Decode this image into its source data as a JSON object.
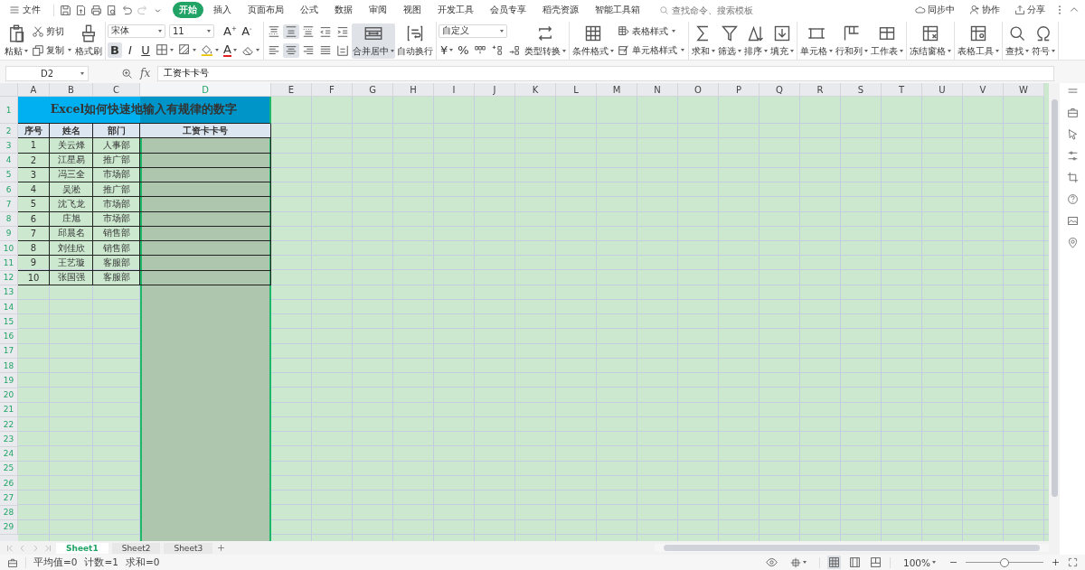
{
  "menu_bar": {
    "file_menu": "文件",
    "tabs": [
      {
        "label": "开始",
        "selected": true
      },
      {
        "label": "插入",
        "selected": false
      },
      {
        "label": "页面布局",
        "selected": false
      },
      {
        "label": "公式",
        "selected": false
      },
      {
        "label": "数据",
        "selected": false
      },
      {
        "label": "审阅",
        "selected": false
      },
      {
        "label": "视图",
        "selected": false
      },
      {
        "label": "开发工具",
        "selected": false
      },
      {
        "label": "会员专享",
        "selected": false
      },
      {
        "label": "稻壳资源",
        "selected": false
      },
      {
        "label": "智能工具箱",
        "selected": false
      }
    ],
    "search": {
      "placeholder": "查找命令、搜索模板"
    },
    "actions": [
      "同步中",
      "协作",
      "分享"
    ]
  },
  "ribbon": {
    "groups": [
      {
        "columns": [
          {
            "rows": [
              [
                {
                  "kind": "large",
                  "label": "粘贴",
                  "menu": true
                }
              ]
            ]
          },
          {
            "rows": [
              [
                {
                  "kind": "small",
                  "label": "剪切",
                  "menu": false
                }
              ],
              [
                {
                  "kind": "small",
                  "label": "复制",
                  "menu": true
                }
              ]
            ]
          },
          {
            "rows": [
              [
                {
                  "kind": "large",
                  "label": "格式刷",
                  "menu": false
                }
              ]
            ]
          }
        ]
      },
      {
        "columns": [
          {
            "rows": [
              [
                {
                  "kind": "dropdown",
                  "value": "宋体"
                },
                {
                  "kind": "dropdown",
                  "value": "11"
                }
              ],
              [
                {
                  "kind": "glyph",
                  "text": "B",
                  "menu": false,
                  "on": true
                },
                {
                  "kind": "glyph",
                  "text": "I",
                  "menu": false,
                  "on": false
                },
                {
                  "kind": "glyph",
                  "text": "U",
                  "menu": false,
                  "on": false
                },
                {
                  "kind": "icon",
                  "menu": true
                },
                {
                  "kind": "icon",
                  "menu": true
                },
                {
                  "kind": "icon",
                  "menu": true
                }
              ]
            ]
          },
          {
            "rows": [
              [
                {
                  "kind": "glyph",
                  "text": "A$^{+}$",
                  "menu": false
                }
              ],
              [
                {
                  "kind": "color-glyph",
                  "text": "A",
                  "menu": true
                }
              ]
            ]
          },
          {
            "rows": [
              [
                {
                  "kind": "glyph",
                  "text": "A$^{-}$",
                  "menu": false
                }
              ],
              [
                {
                  "kind": "icon",
                  "menu": true
                }
              ]
            ]
          }
        ]
      },
      {
        "columns": [
          {
            "rows": [
              [
                {
                  "kind": "icon",
                  "menu": false,
                  "on": false
                },
                {
                  "kind": "icon",
                  "menu": false,
                  "on": true
                },
                {
                  "kind": "icon",
                  "menu": false,
                  "on": false
                },
                {
                  "kind": "icon",
                  "menu": false,
                  "on": false
                },
                {
                  "kind": "icon",
                  "menu": false,
                  "on": false
                }
              ],
              [
                {
                  "kind": "icon",
                  "menu": false,
                  "on": false
                },
                {
                  "kind": "icon",
                  "menu": false,
                  "on": true
                },
                {
                  "kind": "icon",
                  "menu": false,
                  "on": false
                },
                {
                  "kind": "icon",
                  "menu": false,
                  "on": false
                },
                {
                  "kind": "icon",
                  "menu": false,
                  "on": false
                }
              ]
            ]
          },
          {
            "rows": [
              [
                {
                  "kind": "large",
                  "label": "合并居中",
                  "menu": true,
                  "on": true
                }
              ]
            ]
          },
          {
            "rows": [
              [
                {
                  "kind": "large",
                  "label": "自动换行",
                  "menu": false,
                  "on": false
                }
              ]
            ]
          }
        ]
      },
      {
        "columns": [
          {
            "rows": [
              [
                {
                  "kind": "dropdown",
                  "value": "自定义"
                }
              ],
              [
                {
                  "kind": "glyph",
                  "text": "¥",
                  "menu": true
                },
                {
                  "kind": "glyph",
                  "text": "%",
                  "menu": false
                },
                {
                  "kind": "icon",
                  "menu": false
                },
                {
                  "kind": "icon",
                  "menu": false
                },
                {
                  "kind": "icon",
                  "menu": false
                }
              ]
            ]
          },
          {
            "rows": [
              [
                {
                  "kind": "large",
                  "label": "类型转换",
                  "menu": true
                }
              ]
            ]
          }
        ]
      },
      {
        "columns": [
          {
            "rows": [
              [
                {
                  "kind": "large",
                  "label": "条件格式",
                  "menu": true
                }
              ]
            ]
          },
          {
            "rows": [
              [
                {
                  "kind": "small",
                  "label": "表格样式",
                  "menu": true
                }
              ],
              [
                {
                  "kind": "small",
                  "label": "单元格样式",
                  "menu": true
                }
              ]
            ]
          }
        ]
      },
      {
        "columns": [
          {
            "rows": [
              [
                {
                  "kind": "large",
                  "label": "求和",
                  "menu": true
                }
              ]
            ]
          },
          {
            "rows": [
              [
                {
                  "kind": "large",
                  "label": "筛选",
                  "menu": true
                }
              ]
            ]
          },
          {
            "rows": [
              [
                {
                  "kind": "large",
                  "label": "排序",
                  "menu": true
                }
              ]
            ]
          },
          {
            "rows": [
              [
                {
                  "kind": "large",
                  "label": "填充",
                  "menu": true
                }
              ]
            ]
          }
        ]
      },
      {
        "columns": [
          {
            "rows": [
              [
                {
                  "kind": "large",
                  "label": "单元格",
                  "menu": true
                }
              ]
            ]
          },
          {
            "rows": [
              [
                {
                  "kind": "large",
                  "label": "行和列",
                  "menu": true
                }
              ]
            ]
          },
          {
            "rows": [
              [
                {
                  "kind": "large",
                  "label": "工作表",
                  "menu": true
                }
              ]
            ]
          }
        ]
      },
      {
        "columns": [
          {
            "rows": [
              [
                {
                  "kind": "large",
                  "label": "冻结窗格",
                  "menu": true
                }
              ]
            ]
          }
        ]
      },
      {
        "columns": [
          {
            "rows": [
              [
                {
                  "kind": "large",
                  "label": "表格工具",
                  "menu": true
                }
              ]
            ]
          }
        ]
      },
      {
        "columns": [
          {
            "rows": [
              [
                {
                  "kind": "large",
                  "label": "查找",
                  "menu": true
                }
              ]
            ]
          },
          {
            "rows": [
              [
                {
                  "kind": "large",
                  "label": "符号",
                  "menu": true
                }
              ]
            ]
          }
        ]
      }
    ]
  },
  "formula_bar": {
    "cell_ref": "D2",
    "fx": "fx",
    "value": "工资卡卡号"
  },
  "sheet": {
    "columns": [
      {
        "label": "A",
        "selected": false
      },
      {
        "label": "B",
        "selected": false
      },
      {
        "label": "C",
        "selected": false
      },
      {
        "label": "D",
        "selected": true
      },
      {
        "label": "E",
        "selected": false
      },
      {
        "label": "F",
        "selected": false
      },
      {
        "label": "G",
        "selected": false
      },
      {
        "label": "H",
        "selected": false
      },
      {
        "label": "I",
        "selected": false
      },
      {
        "label": "J",
        "selected": false
      },
      {
        "label": "K",
        "selected": false
      },
      {
        "label": "L",
        "selected": false
      },
      {
        "label": "M",
        "selected": false
      },
      {
        "label": "N",
        "selected": false
      },
      {
        "label": "O",
        "selected": false
      },
      {
        "label": "P",
        "selected": false
      },
      {
        "label": "Q",
        "selected": false
      },
      {
        "label": "R",
        "selected": false
      },
      {
        "label": "S",
        "selected": false
      },
      {
        "label": "T",
        "selected": false
      },
      {
        "label": "U",
        "selected": false
      },
      {
        "label": "V",
        "selected": false
      },
      {
        "label": "W",
        "selected": false
      }
    ],
    "rows": [
      "1",
      "2",
      "3",
      "4",
      "5",
      "6",
      "7",
      "8",
      "9",
      "10",
      "11",
      "12",
      "13",
      "14",
      "15",
      "16",
      "17",
      "18",
      "19",
      "20",
      "21",
      "22",
      "23",
      "24",
      "25",
      "26",
      "27",
      "28",
      "29"
    ],
    "table": {
      "title": "Excel如何快速地输入有规律的数字",
      "headers": [
        "序号",
        "姓名",
        "部门",
        "工资卡卡号"
      ],
      "records": [
        [
          "1",
          "关云烽",
          "人事部"
        ],
        [
          "2",
          "江星易",
          "推广部"
        ],
        [
          "3",
          "冯三全",
          "市场部"
        ],
        [
          "4",
          "吴淞",
          "推广部"
        ],
        [
          "5",
          "沈飞龙",
          "市场部"
        ],
        [
          "6",
          "庄旭",
          "市场部"
        ],
        [
          "7",
          "邱晨名",
          "销售部"
        ],
        [
          "8",
          "刘佳欣",
          "销售部"
        ],
        [
          "9",
          "王艺璇",
          "客服部"
        ],
        [
          "10",
          "张国强",
          "客服部"
        ]
      ]
    }
  },
  "sheet_tabs": [
    {
      "label": "Sheet1",
      "selected": true
    },
    {
      "label": "Sheet2",
      "selected": false
    },
    {
      "label": "Sheet3",
      "selected": false
    }
  ],
  "status_bar": {
    "stats": [
      "平均值=0",
      "计数=1",
      "求和=0"
    ],
    "views": [
      {
        "selected": true
      },
      {
        "selected": false
      },
      {
        "selected": false
      }
    ],
    "zoom": {
      "label": "100%",
      "level": 0.5
    }
  }
}
